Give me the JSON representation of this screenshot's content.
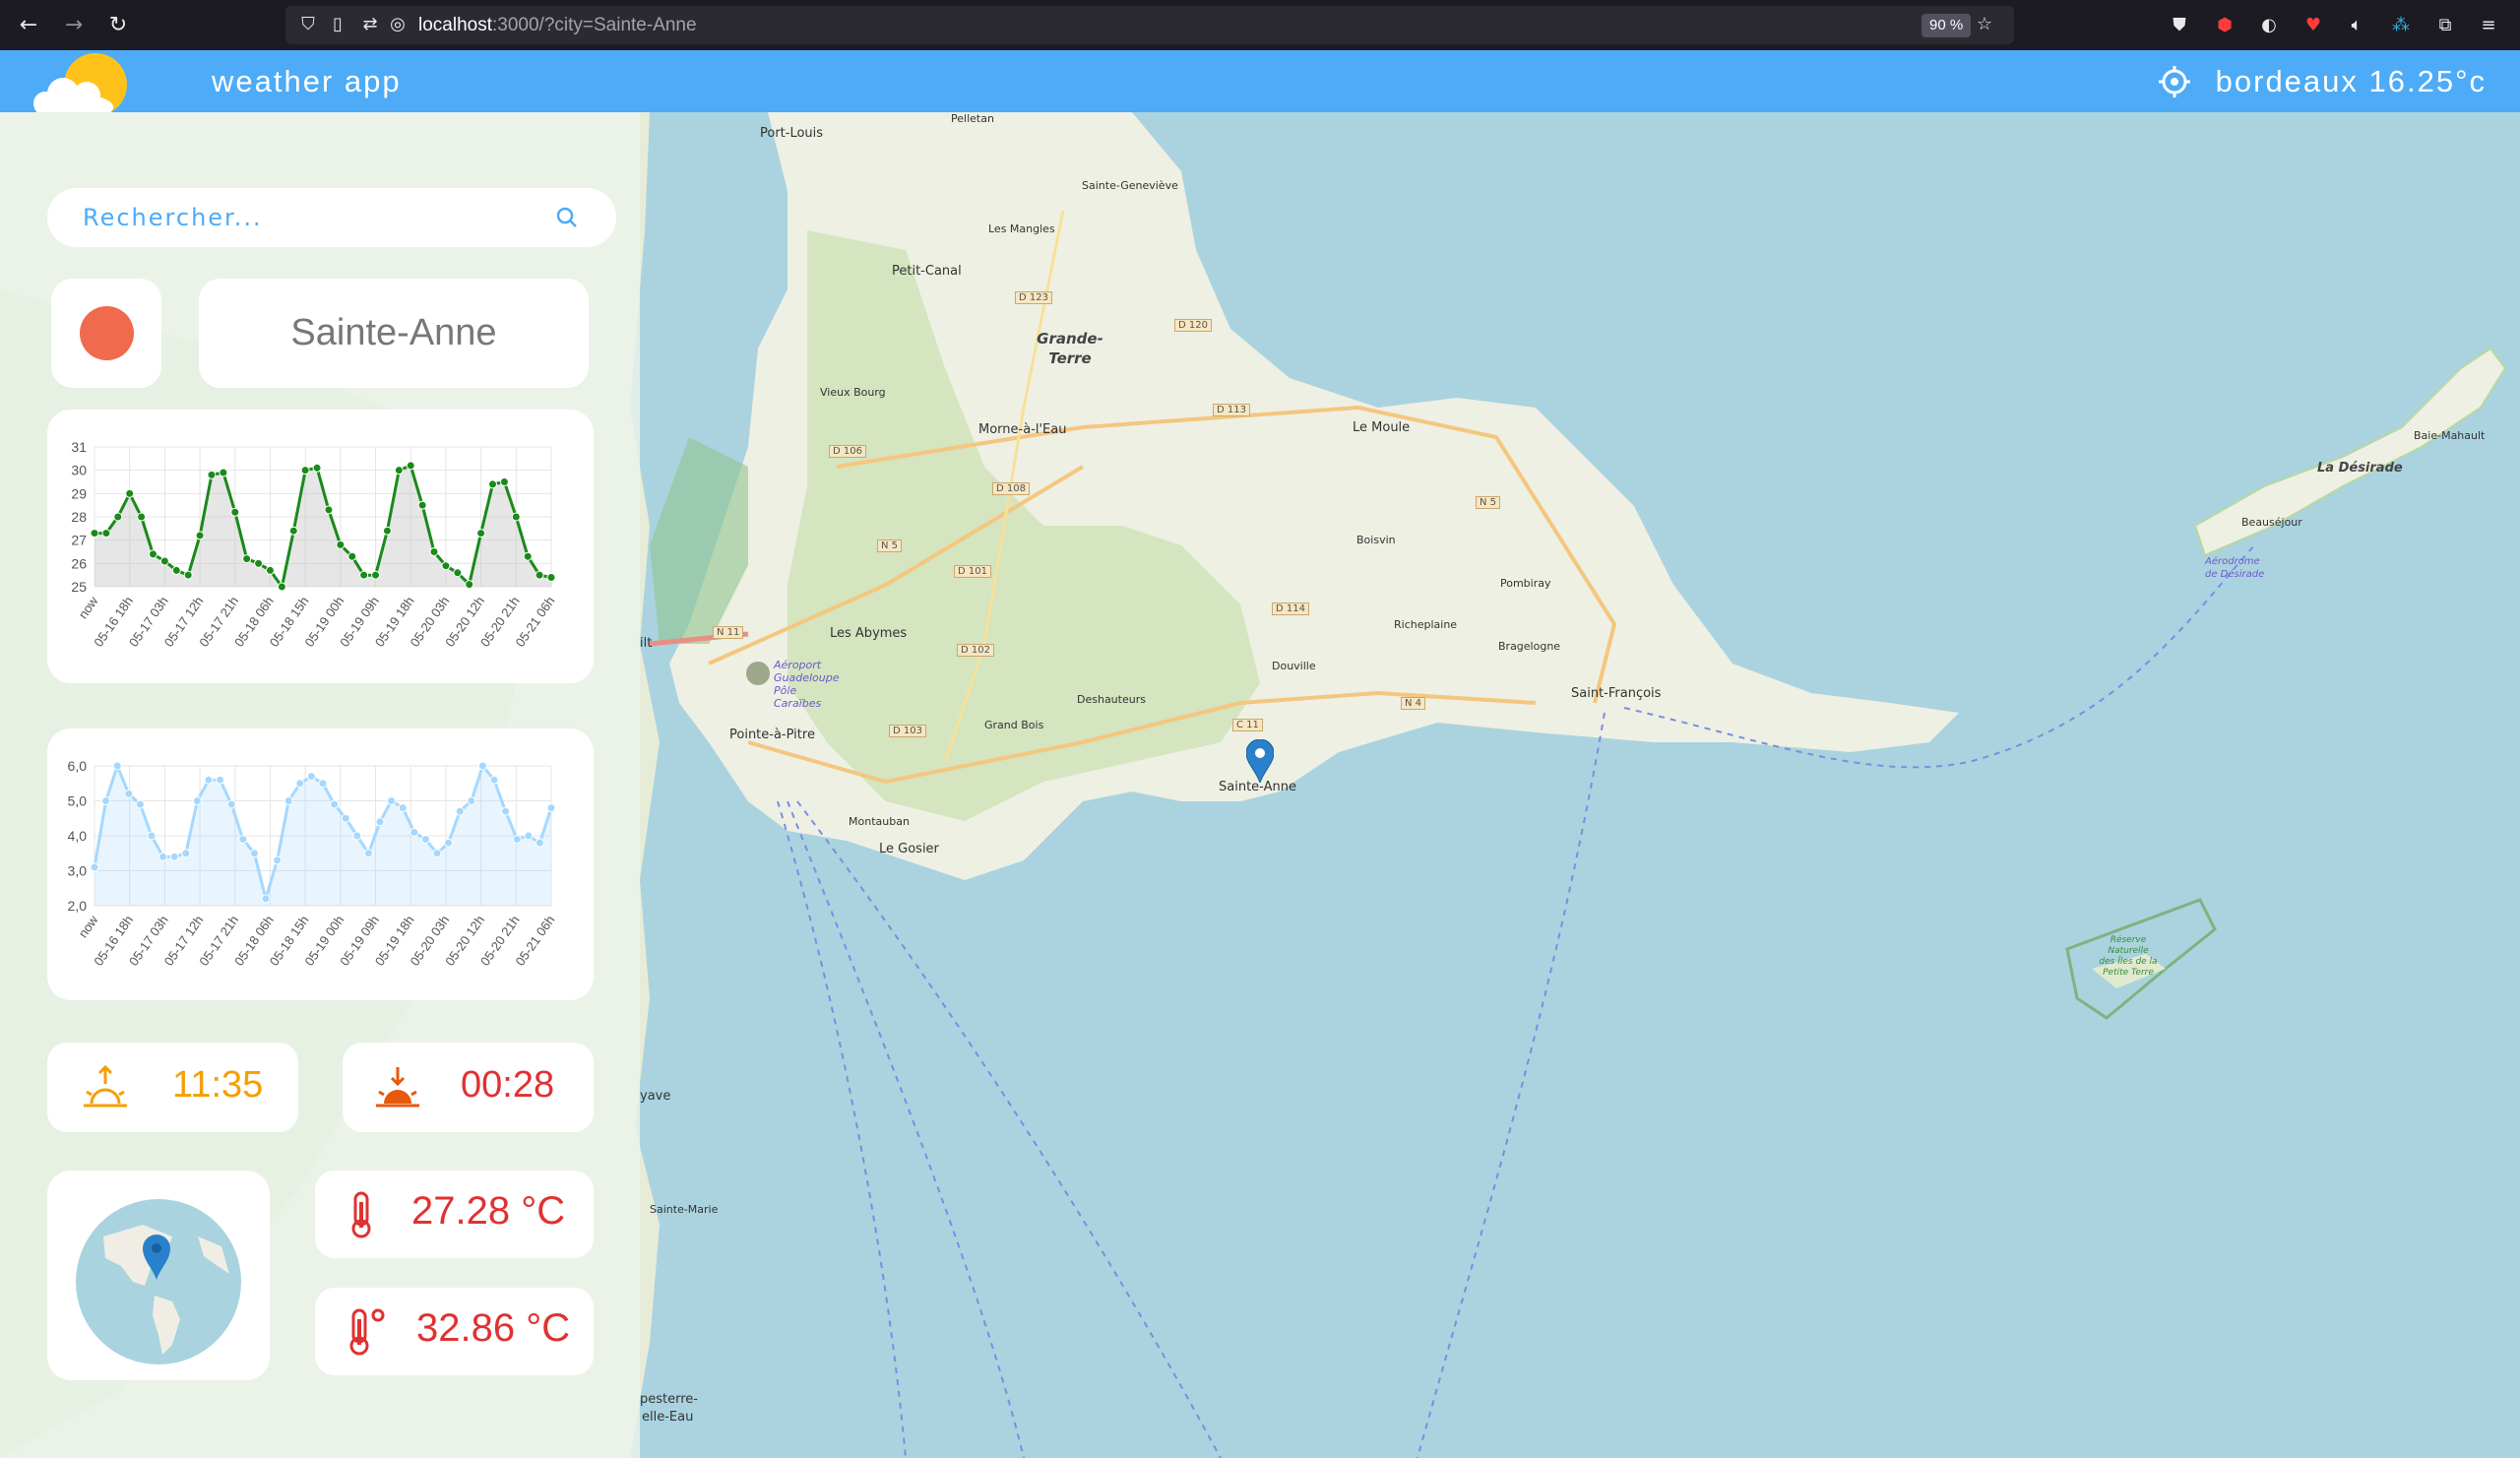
{
  "browser": {
    "url_host": "localhost",
    "url_rest": ":3000/?city=Sainte-Anne",
    "zoom": "90 %",
    "extensions": [
      "pocket-icon",
      "adblock-icon",
      "privacy-icon",
      "youtube-icon",
      "sound-icon",
      "translate-icon",
      "extensions-icon",
      "menu-icon"
    ]
  },
  "header": {
    "title": "weather app",
    "current_location": "bordeaux 16.25°c"
  },
  "search": {
    "placeholder": "Rechercher..."
  },
  "city": {
    "name": "Sainte-Anne",
    "status_color": "#f06a4d"
  },
  "temp_chart": {
    "chart_data": {
      "type": "line",
      "categories": [
        "now",
        "05-16 18h",
        "05-17 03h",
        "05-17 12h",
        "05-17 21h",
        "05-18 06h",
        "05-18 15h",
        "05-19 00h",
        "05-19 09h",
        "05-19 18h",
        "05-20 03h",
        "05-20 12h",
        "05-20 21h",
        "05-21 06h"
      ],
      "x_count": 40,
      "values": [
        27.3,
        27.3,
        28.0,
        29.0,
        28.0,
        26.4,
        26.1,
        25.7,
        25.5,
        27.2,
        29.8,
        29.9,
        28.2,
        26.2,
        26.0,
        25.7,
        25.0,
        27.4,
        30.0,
        30.1,
        28.3,
        26.8,
        26.3,
        25.5,
        25.5,
        27.4,
        30.0,
        30.2,
        28.5,
        26.5,
        25.9,
        25.6,
        25.1,
        27.3,
        29.4,
        29.5,
        28.0,
        26.3,
        25.5,
        25.4
      ],
      "ylim": [
        25,
        31
      ],
      "yticks": [
        "25",
        "26",
        "27",
        "28",
        "29",
        "30",
        "31"
      ],
      "color": "#1a8a1a",
      "grid": true
    }
  },
  "wind_chart": {
    "chart_data": {
      "type": "line",
      "categories": [
        "now",
        "05-16 18h",
        "05-17 03h",
        "05-17 12h",
        "05-17 21h",
        "05-18 06h",
        "05-18 15h",
        "05-19 00h",
        "05-19 09h",
        "05-19 18h",
        "05-20 03h",
        "05-20 12h",
        "05-20 21h",
        "05-21 06h"
      ],
      "x_count": 40,
      "values": [
        3.1,
        5.0,
        6.0,
        5.2,
        4.9,
        4.0,
        3.4,
        3.4,
        3.5,
        5.0,
        5.6,
        5.6,
        4.9,
        3.9,
        3.5,
        2.2,
        3.3,
        5.0,
        5.5,
        5.7,
        5.5,
        4.9,
        4.5,
        4.0,
        3.5,
        4.4,
        5.0,
        4.8,
        4.1,
        3.9,
        3.5,
        3.8,
        4.7,
        5.0,
        6.0,
        5.6,
        4.7,
        3.9,
        4.0,
        3.8,
        4.8
      ],
      "ylim": [
        2.0,
        6.0
      ],
      "yticks": [
        "2,0",
        "3,0",
        "4,0",
        "5,0",
        "6,0"
      ],
      "color": "#a5d8ff",
      "grid": true
    }
  },
  "sun": {
    "sunrise": "11:35",
    "sunset": "00:28"
  },
  "temperature": {
    "current": "27.28 °C",
    "feels_like": "32.86 °C"
  },
  "map": {
    "places": [
      "Port-Louis",
      "Pelletan",
      "Sainte-Geneviève",
      "Les Mangles",
      "Petit-Canal",
      "Grande-Terre",
      "Vieux Bourg",
      "Morne-à-l'Eau",
      "Le Moule",
      "Boisvin",
      "Pombiray",
      "Les Abymes",
      "Aéroport Guadeloupe Pôle Caraïbes",
      "Richeplaine",
      "Bragelogne",
      "Douville",
      "Deshauteurs",
      "Grand Bois",
      "Pointe-à-Pitre",
      "Saint-François",
      "Sainte-Anne",
      "Montauban",
      "Le Gosier",
      "La Désirade",
      "Baie-Mahault",
      "Beauséjour",
      "Aérodrome de Désirade",
      "Réserve Naturelle des Îles de la Petite Terre",
      "ilt",
      "Sainte-Marie",
      "yave",
      "pesterre-",
      "elle-Eau"
    ],
    "roads": [
      "D 123",
      "D 120",
      "D 113",
      "D 106",
      "D 108",
      "N 5",
      "N 5",
      "D 101",
      "D 114",
      "N 11",
      "D 102",
      "D 103",
      "N 4",
      "C 11"
    ]
  }
}
